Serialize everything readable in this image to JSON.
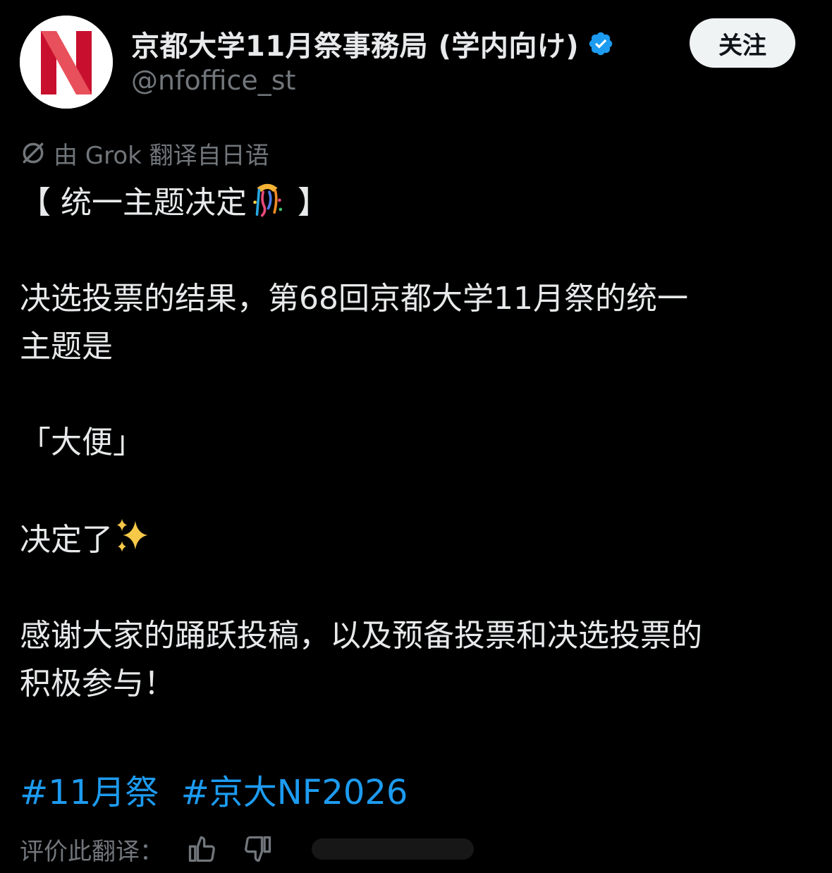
{
  "author": {
    "display_name": "京都大学11月祭事務局 (学内向け)",
    "handle": "@nfoffice_st",
    "verified": true,
    "avatar_letter": "N"
  },
  "follow_button": "关注",
  "translation_notice": "由 Grok 翻译自日语",
  "post": {
    "line1": "【 统一主题决定",
    "line1_end": " 】",
    "line2": "决选投票的结果，第68回京都大学11月祭的统一",
    "line3": "主题是",
    "line4": "「大便」",
    "line5": "决定了",
    "line6": "感谢大家的踊跃投稿，以及预备投票和决选投票的",
    "line7": "积极参与！"
  },
  "hashtags": [
    "#11月祭",
    "#京大NF2026"
  ],
  "rate_translation_label": "评价此翻译：",
  "colors": {
    "background": "#000000",
    "text": "#e7e9ea",
    "muted": "#71767b",
    "link": "#1d9bf0",
    "verified": "#1d9bf0",
    "avatar_red": "#d3263a"
  },
  "icons": {
    "verified": "verified-badge-icon",
    "translate": "grok-slash-icon",
    "confetti": "party-popper-emoji",
    "sparkles": "sparkles-emoji",
    "thumbs_up": "thumbs-up-icon",
    "thumbs_down": "thumbs-down-icon"
  }
}
